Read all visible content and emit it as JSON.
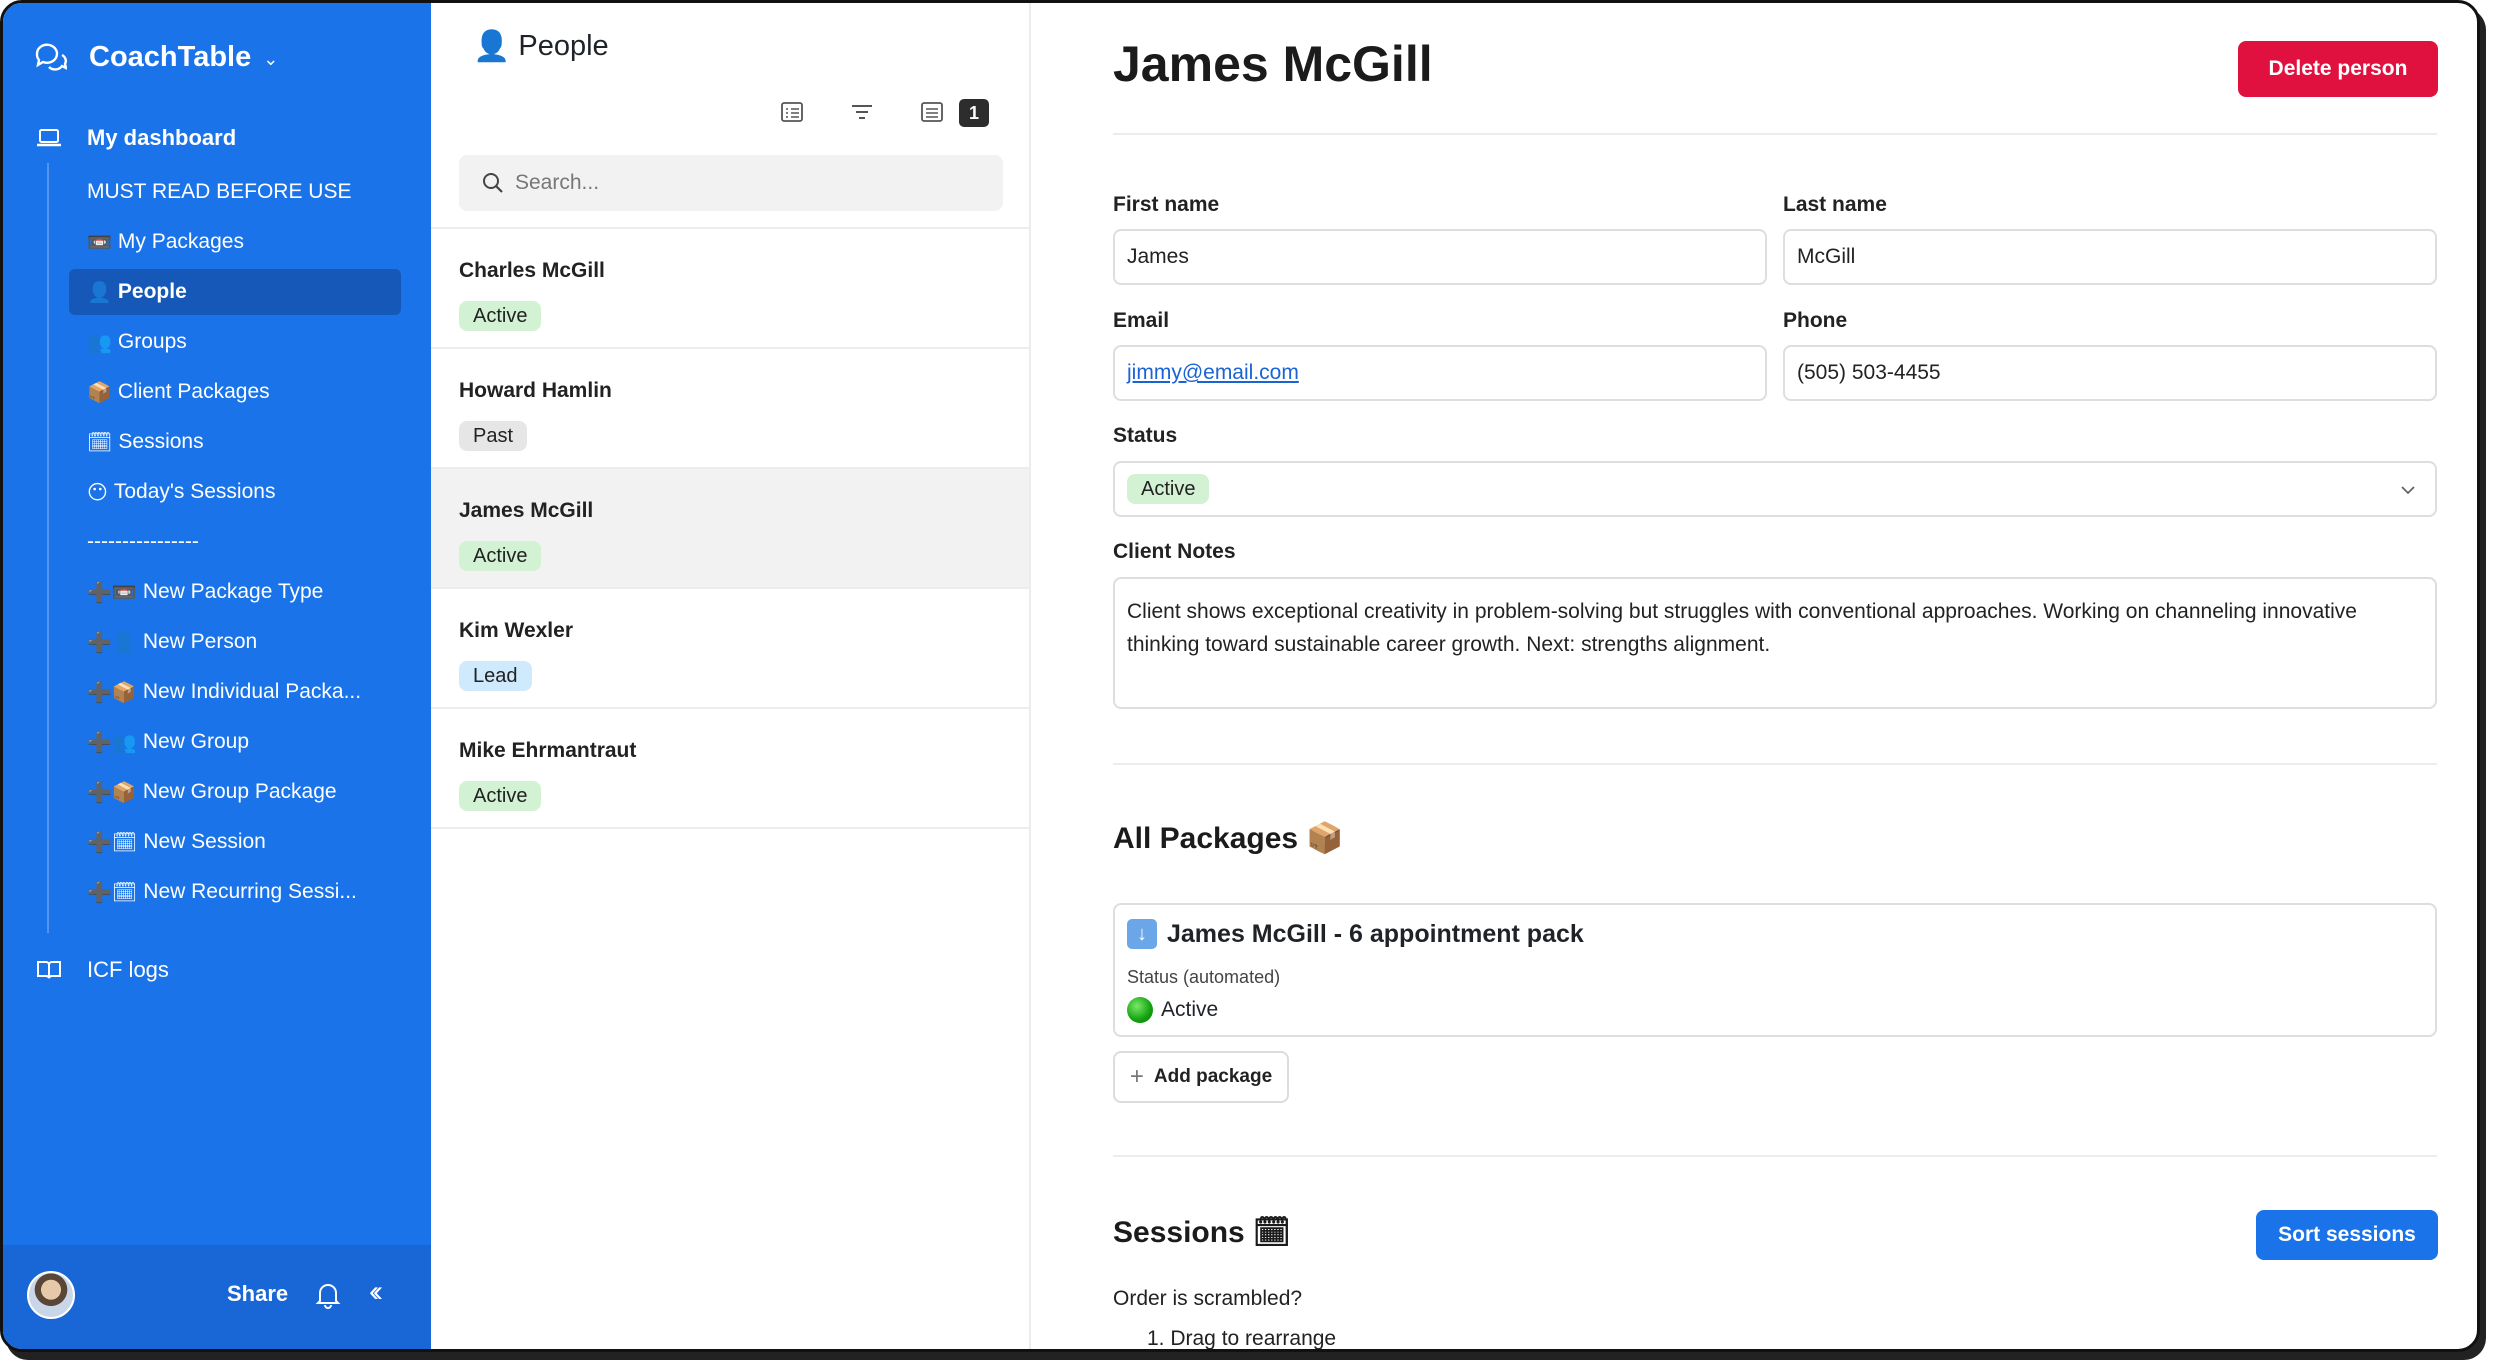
{
  "sidebar": {
    "workspace_name": "CoachTable",
    "nav": [
      {
        "label": "My dashboard",
        "icon": "laptop-icon"
      },
      {
        "label": "ICF logs",
        "icon": "book-icon"
      }
    ],
    "items": [
      {
        "emoji": "",
        "label": "MUST READ BEFORE USE"
      },
      {
        "emoji": "📼",
        "label": "My Packages"
      },
      {
        "emoji": "👤",
        "label": "People"
      },
      {
        "emoji": "👥",
        "label": "Groups"
      },
      {
        "emoji": "📦",
        "label": "Client Packages"
      },
      {
        "emoji": "🗓",
        "label": "Sessions"
      },
      {
        "emoji": "😶",
        "label": "Today's Sessions"
      },
      {
        "emoji": "",
        "label": "----------------"
      },
      {
        "emoji": "➕📼",
        "label": "New Package Type"
      },
      {
        "emoji": "➕👤",
        "label": "New Person"
      },
      {
        "emoji": "➕📦",
        "label": "New Individual Packa..."
      },
      {
        "emoji": "➕👥",
        "label": "New Group"
      },
      {
        "emoji": "➕📦",
        "label": "New Group Package"
      },
      {
        "emoji": "➕🗓",
        "label": "New Session"
      },
      {
        "emoji": "➕🗓",
        "label": "New Recurring Sessi..."
      }
    ],
    "footer": {
      "share_label": "Share"
    }
  },
  "list": {
    "title_emoji": "👤",
    "title": "People",
    "filter_count": "1",
    "search_placeholder": "Search...",
    "people": [
      {
        "name": "Charles McGill",
        "status": "Active"
      },
      {
        "name": "Howard Hamlin",
        "status": "Past"
      },
      {
        "name": "James McGill",
        "status": "Active"
      },
      {
        "name": "Kim Wexler",
        "status": "Lead"
      },
      {
        "name": "Mike Ehrmantraut",
        "status": "Active"
      }
    ]
  },
  "detail": {
    "title": "James McGill",
    "delete_label": "Delete person",
    "first_name_label": "First name",
    "first_name": "James",
    "last_name_label": "Last name",
    "last_name": "McGill",
    "email_label": "Email",
    "email": "jimmy@email.com",
    "phone_label": "Phone",
    "phone": "(505) 503-4455",
    "status_label": "Status",
    "status": "Active",
    "notes_label": "Client Notes",
    "notes": "Client shows exceptional creativity in problem-solving but struggles with conventional approaches. Working on channeling innovative thinking toward sustainable career growth. Next: strengths alignment.",
    "packages_title": "All Packages",
    "packages_emoji": "📦",
    "package": {
      "title": "James McGill - 6 appointment pack",
      "status_label": "Status (automated)",
      "status": "Active"
    },
    "add_package_label": "Add package",
    "sessions_title": "Sessions",
    "sessions_emoji": "🗓",
    "sort_label": "Sort sessions",
    "order_text": "Order is scrambled?",
    "step_1": "1. Drag to rearrange"
  },
  "colors": {
    "sidebar_bg": "#1a73e8",
    "danger": "#e0113f",
    "active_tag": "#d3f2d4",
    "lead_tag": "#cfeafc",
    "past_tag": "#e6e6e6"
  }
}
